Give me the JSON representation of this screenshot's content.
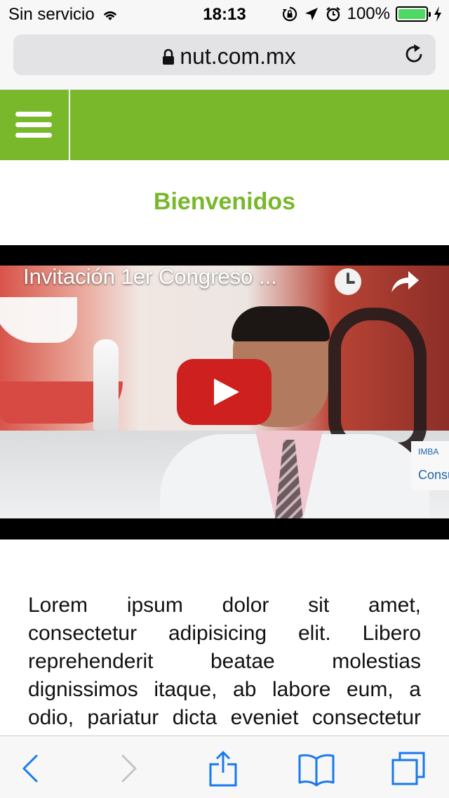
{
  "status_bar": {
    "carrier": "Sin servicio",
    "time": "18:13",
    "battery": "100%",
    "battery_level": 1.0,
    "icons": [
      "wifi-icon",
      "rotation-lock-icon",
      "location-icon",
      "alarm-icon",
      "battery-icon",
      "charging-icon"
    ]
  },
  "browser": {
    "url": "nut.com.mx",
    "icons": [
      "lock-icon",
      "reload-icon"
    ],
    "toolbar_icons": [
      "back-icon",
      "forward-icon",
      "share-icon",
      "bookmarks-icon",
      "tabs-icon"
    ]
  },
  "site": {
    "header_color": "#78b82a",
    "menu_icon": "hamburger-icon",
    "welcome": "Bienvenidos"
  },
  "video": {
    "title": "Invitación 1er Congreso ...",
    "logo_text_top": "IMBA",
    "logo_text_bottom": "Consu",
    "icons": [
      "watch-later-icon",
      "share-icon",
      "youtube-play-icon"
    ],
    "play_color": "#cd201f"
  },
  "content": {
    "lorem_lines": [
      "Lorem ipsum dolor sit amet,",
      "consectetur adipisicing elit. Libero",
      "reprehenderit beatae molestias",
      "dignissimos itaque, ab labore eum, a",
      "odio, pariatur dicta eveniet consectetur"
    ]
  }
}
